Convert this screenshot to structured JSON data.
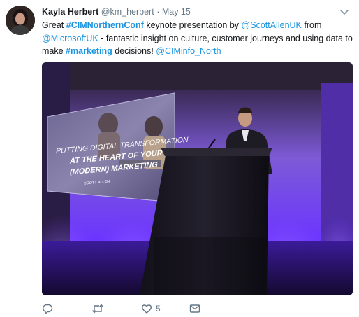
{
  "tweet": {
    "name": "Kayla Herbert",
    "handle": "@km_herbert",
    "separator": "·",
    "date": "May 15",
    "text": {
      "p1": "Great ",
      "hashtag1": "#CIMNorthernConf",
      "p2": " keynote presentation by ",
      "mention1": "@ScottAllenUK",
      "p3": " from ",
      "mention2": "@MicrosoftUK",
      "p4": " - fantastic insight on culture, customer journeys and using data to make ",
      "hashtag2": "#marketing",
      "p5": " decisions! ",
      "mention3": "@CIMinfo_North"
    },
    "slide": {
      "line1": "PUTTING DIGITAL TRANSFORMATION",
      "line2": "AT THE HEART OF YOUR",
      "line3": "(MODERN) MARKETING",
      "presenter": "SCOTT ALLEN"
    },
    "actions": {
      "like_count": "5"
    }
  },
  "icons": [
    "reply-icon",
    "retweet-icon",
    "like-icon",
    "message-icon",
    "chevron-down-icon"
  ],
  "colors": {
    "link": "#1b95e0",
    "muted": "#657786",
    "stage_purple": "#7a3cff"
  }
}
